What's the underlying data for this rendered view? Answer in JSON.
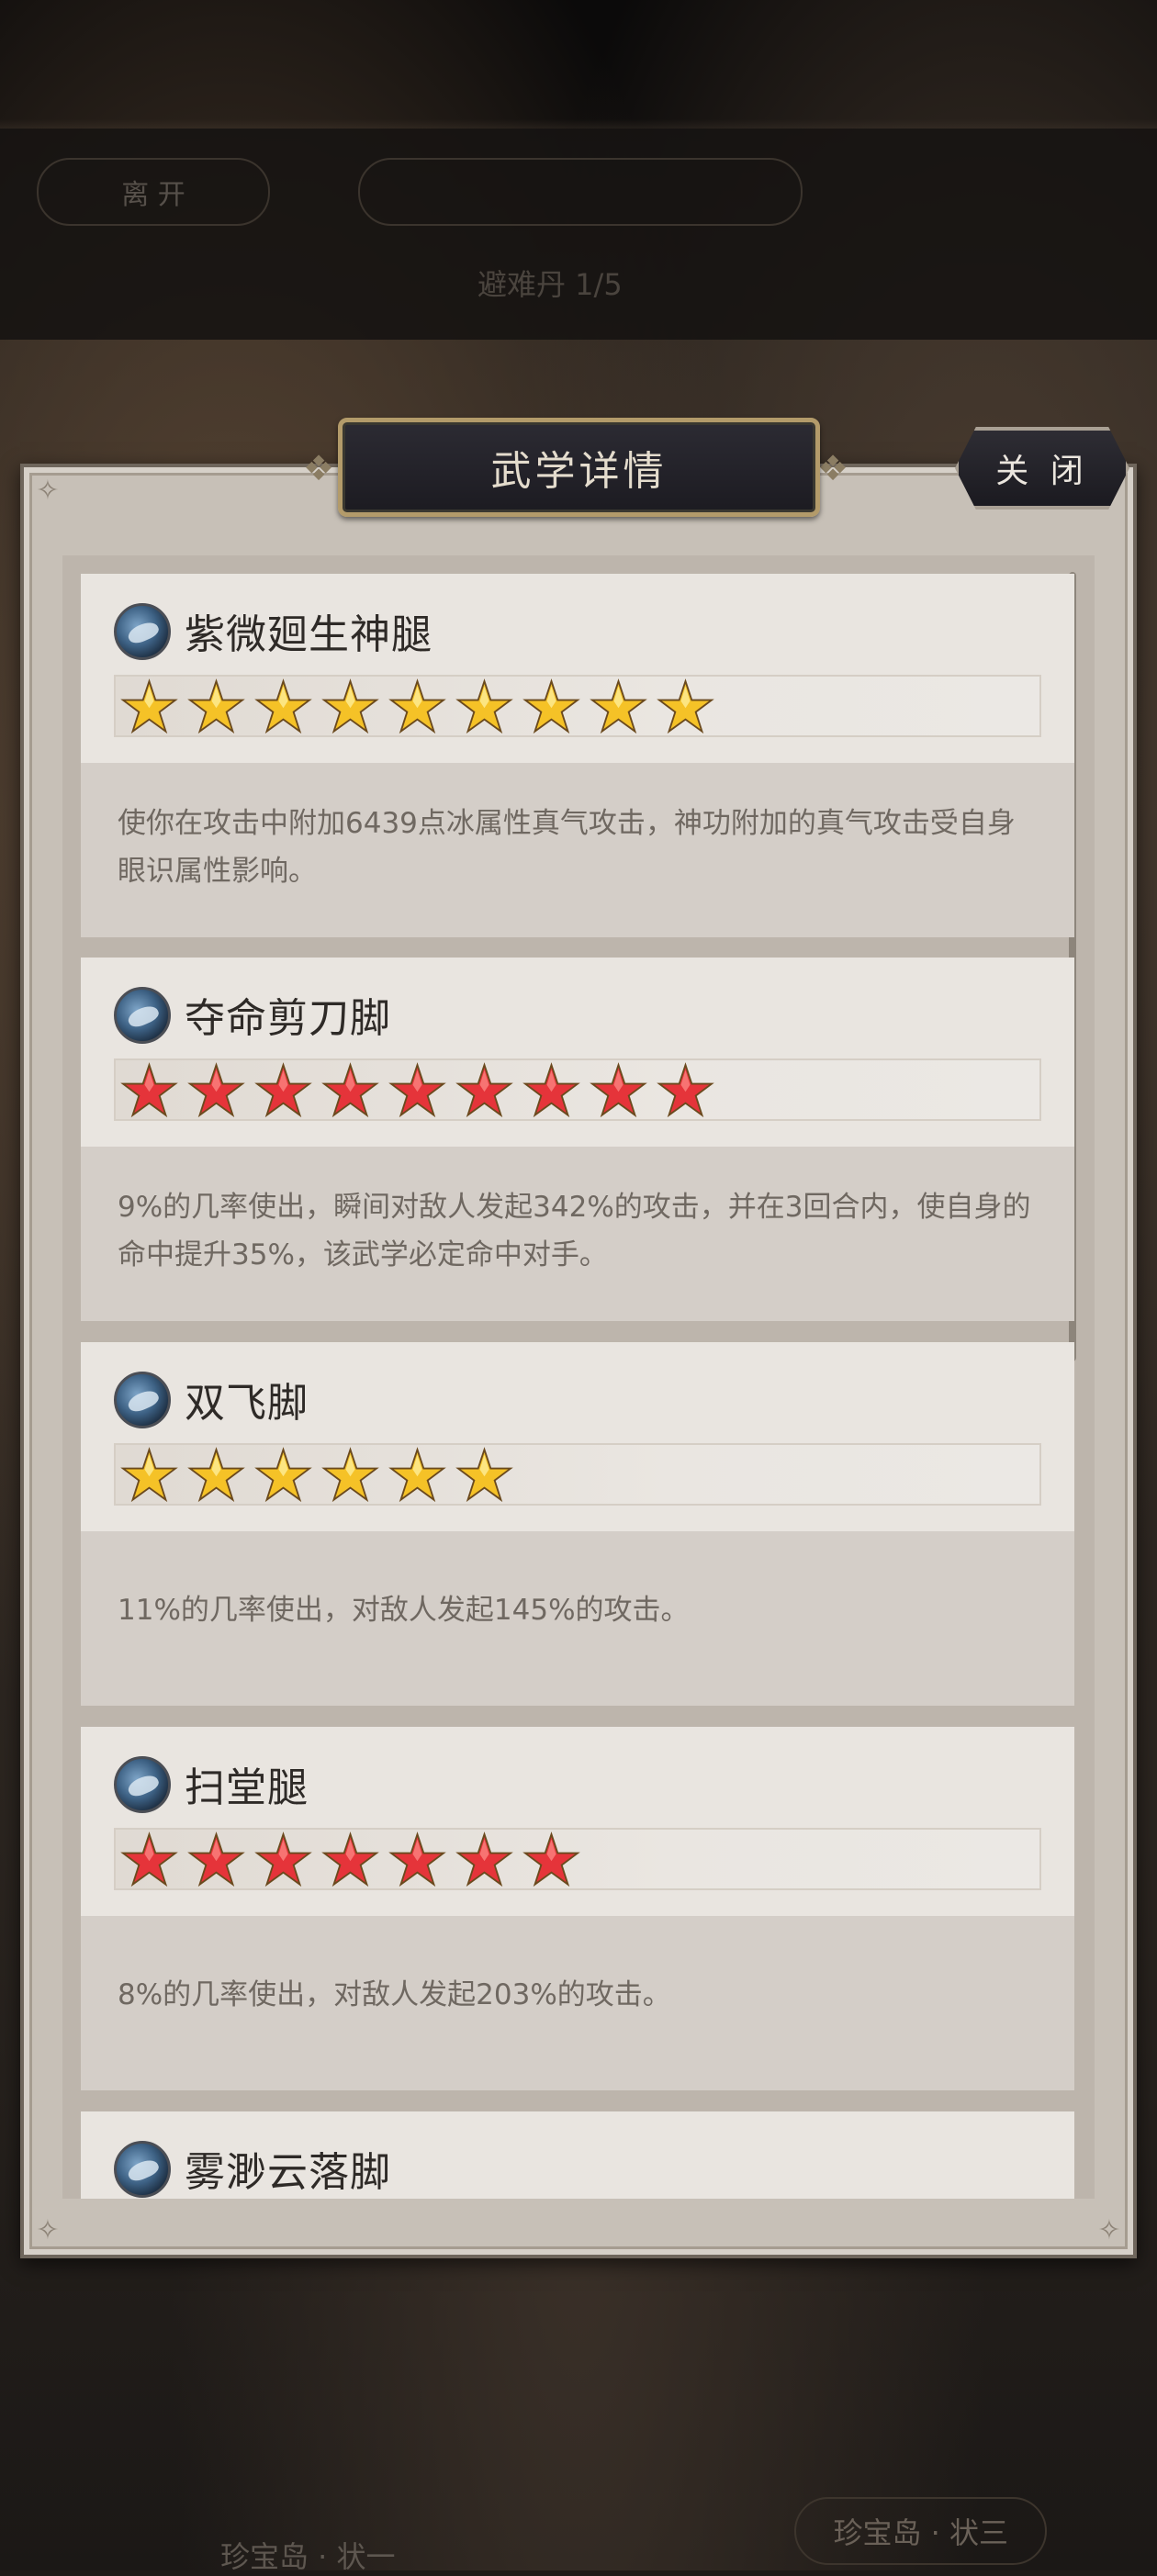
{
  "background": {
    "leave_label": "离 开",
    "sub_text": "避难丹 1/5",
    "hint_right": "珍宝岛 · 状三",
    "hint_left": "珍宝岛 · 状一"
  },
  "dialog": {
    "title": "武学详情",
    "close_label": "关 闭"
  },
  "skills": [
    {
      "name": "紫微廻生神腿",
      "stars": 9,
      "star_color": "gold",
      "description": "使你在攻击中附加6439点冰属性真气攻击，神功附加的真气攻击受自身眼识属性影响。"
    },
    {
      "name": "夺命剪刀脚",
      "stars": 9,
      "star_color": "red",
      "description": "9%的几率使出，瞬间对敌人发起342%的攻击，并在3回合内，使自身的命中提升35%，该武学必定命中对手。"
    },
    {
      "name": "双飞脚",
      "stars": 6,
      "star_color": "gold",
      "description": "11%的几率使出，对敌人发起145%的攻击。"
    },
    {
      "name": "扫堂腿",
      "stars": 7,
      "star_color": "red",
      "description": "8%的几率使出，对敌人发起203%的攻击。"
    },
    {
      "name": "雾渺云落脚"
    }
  ],
  "colors": {
    "gold_star": "#f5c227",
    "red_star": "#e5343a",
    "dialog_bg": "#c7c0b7",
    "card_head": "#e9e5e0",
    "card_desc": "#d4cec8"
  }
}
